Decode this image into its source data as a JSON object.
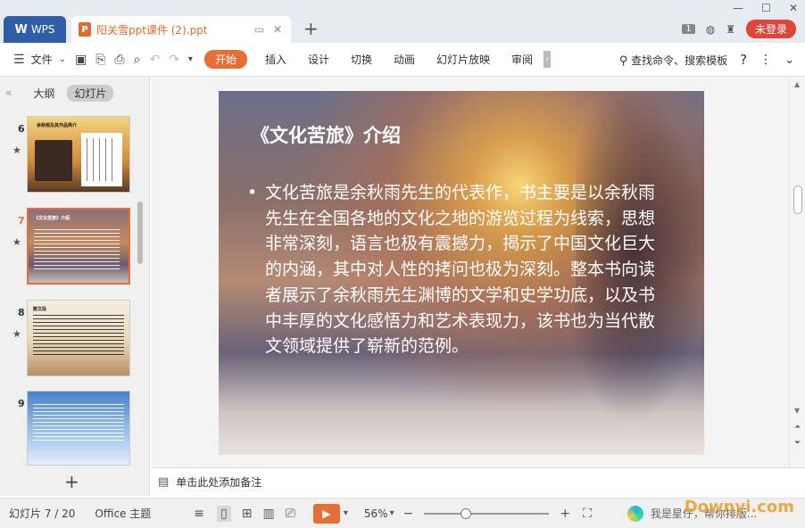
{
  "titlebar": {
    "wps_label": "WPS",
    "doc_title": "阳关雪ppt课件 (2).ppt",
    "ppt_icon_letter": "P",
    "page_count_badge": "1",
    "login_label": "未登录"
  },
  "ribbon": {
    "file_label": "文件",
    "tabs": [
      "开始",
      "插入",
      "设计",
      "切换",
      "动画",
      "幻灯片放映",
      "审阅"
    ],
    "search_label": "查找命令、搜索模板"
  },
  "left_panel": {
    "tab_outline": "大纲",
    "tab_slides": "幻灯片",
    "thumbnails": [
      {
        "num": "6",
        "caption": "余秋雨及其作品简介"
      },
      {
        "num": "7",
        "caption": "《文化苦旅》介绍"
      },
      {
        "num": "8",
        "caption": "散文段"
      },
      {
        "num": "9",
        "caption": ""
      }
    ]
  },
  "slide": {
    "title": "《文化苦旅》介绍",
    "bullet": "•",
    "body": "文化苦旅是余秋雨先生的代表作，书主要是以余秋雨先生在全国各地的文化之地的游览过程为线索，思想非常深刻，语言也极有震撼力，揭示了中国文化巨大的内涵，其中对人性的拷问也极为深刻。整本书向读者展示了余秋雨先生渊博的文学和史学功底，以及书中丰厚的文化感悟力和艺术表现力，该书也为当代散文领域提供了崭新的范例。"
  },
  "notes": {
    "placeholder": "单击此处添加备注"
  },
  "statusbar": {
    "slide_indicator": "幻灯片 7 / 20",
    "theme": "Office 主题",
    "zoom": "56%",
    "zoom_value": 56,
    "assistant": "我是星仔，帮你排版..."
  },
  "watermark": "Downyi.com",
  "colors": {
    "accent": "#e56f35",
    "wps_blue": "#2f5ea8",
    "login_red": "#e0453b"
  }
}
